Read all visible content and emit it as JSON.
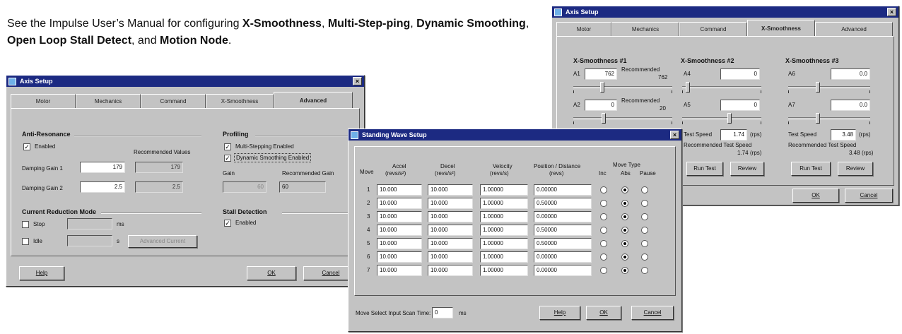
{
  "intro": {
    "t1": "See the Impulse User’s Manual for configuring ",
    "b1": "X-Smoothness",
    "t2": ", ",
    "b2": "Multi-Step-ping",
    "t3": ", ",
    "b3": "Dynamic Smoothing",
    "t4": ", ",
    "b4": "Open Loop Stall Detect",
    "t5": ", and ",
    "b5": "Motion Node",
    "t6": "."
  },
  "axis_left": {
    "title": "Axis Setup",
    "tabs": [
      "Motor",
      "Mechanics",
      "Command",
      "X-Smoothness",
      "Advanced"
    ],
    "active_tab": "Advanced",
    "anti_resonance": {
      "heading": "Anti-Resonance",
      "enabled_label": "Enabled",
      "enabled": true,
      "recommended_label": "Recommended Values",
      "gain1_label": "Damping Gain 1",
      "gain1_value": "179",
      "gain1_rec": "179",
      "gain2_label": "Damping Gain 2",
      "gain2_value": "2.5",
      "gain2_rec": "2.5"
    },
    "profiling": {
      "heading": "Profiling",
      "multi_label": "Multi-Stepping Enabled",
      "dynamic_label": "Dynamic Smoothing Enabled",
      "gain_label": "Gain",
      "rec_gain_label": "Recommended Gain",
      "gain_value": "60",
      "rec_gain_value": "60"
    },
    "current_reduction": {
      "heading": "Current Reduction Mode",
      "stop_label": "Stop",
      "stop_unit": "ms",
      "idle_label": "Idle",
      "idle_unit": "s",
      "apply_label": "Advanced Current"
    },
    "stall": {
      "heading": "Stall Detection",
      "enabled_label": "Enabled"
    },
    "buttons": {
      "help": "Help",
      "ok": "OK",
      "cancel": "Cancel"
    }
  },
  "axis_right": {
    "title": "Axis Setup",
    "tabs": [
      "Motor",
      "Mechanics",
      "Command",
      "X-Smoothness",
      "Advanced"
    ],
    "groups": [
      {
        "heading": "X-Smoothness #1",
        "a_label": "A1",
        "a_value": "762",
        "a_rec_label": "Recommended",
        "a_rec": "762",
        "b_label": "A2",
        "b_value": "0",
        "b_rec_label": "Recommended",
        "b_rec": "20",
        "thumb_a": 0.28,
        "thumb_b": 0.3
      },
      {
        "heading": "X-Smoothness #2",
        "a_label": "A4",
        "a_value": "0",
        "b_label": "A5",
        "b_value": "0",
        "thumb_a": 0.05,
        "thumb_b": 0.6
      },
      {
        "heading": "X-Smoothness #3",
        "a_label": "A6",
        "a_value": "0.0",
        "b_label": "A7",
        "b_value": "0.0",
        "thumb_a": 0.35,
        "thumb_b": 0.35
      }
    ],
    "test2": {
      "speed_label": "Test Speed",
      "speed_value": "1.74",
      "unit": "(rps)",
      "rec_label": "Recommended Test Speed",
      "rec_value": "1.74",
      "run": "Run Test",
      "review": "Review"
    },
    "test3": {
      "speed_label": "Test Speed",
      "speed_value": "3.48",
      "unit": "(rps)",
      "rec_label": "Recommended Test Speed",
      "rec_value": "3.48",
      "run": "Run Test",
      "review": "Review"
    },
    "buttons": {
      "ok": "OK",
      "cancel": "Cancel"
    }
  },
  "standing_wave": {
    "title": "Standing Wave Setup",
    "headers": {
      "move": "Move",
      "accel": "Accel",
      "accel_unit": "(revs/s²)",
      "decel": "Decel",
      "decel_unit": "(revs/s²)",
      "velocity": "Velocity",
      "velocity_unit": "(revs/s)",
      "position": "Position / Distance",
      "position_unit": "(revs)",
      "move_type": "Move Type",
      "inc": "Inc",
      "abs": "Abs",
      "pause": "Pause"
    },
    "rows": [
      {
        "move": "1",
        "accel": "10.000",
        "decel": "10.000",
        "velocity": "1.00000",
        "position": "0.00000",
        "type": "abs"
      },
      {
        "move": "2",
        "accel": "10.000",
        "decel": "10.000",
        "velocity": "1.00000",
        "position": "0.50000",
        "type": "abs"
      },
      {
        "move": "3",
        "accel": "10.000",
        "decel": "10.000",
        "velocity": "1.00000",
        "position": "0.00000",
        "type": "abs"
      },
      {
        "move": "4",
        "accel": "10.000",
        "decel": "10.000",
        "velocity": "1.00000",
        "position": "0.50000",
        "type": "abs"
      },
      {
        "move": "5",
        "accel": "10.000",
        "decel": "10.000",
        "velocity": "1.00000",
        "position": "0.50000",
        "type": "abs"
      },
      {
        "move": "6",
        "accel": "10.000",
        "decel": "10.000",
        "velocity": "1.00000",
        "position": "0.00000",
        "type": "abs"
      },
      {
        "move": "7",
        "accel": "10.000",
        "decel": "10.000",
        "velocity": "1.00000",
        "position": "0.00000",
        "type": "abs"
      }
    ],
    "scan_label": "Move Select Input Scan Time:",
    "scan_value": "0",
    "scan_unit": "ms",
    "buttons": {
      "help": "Help",
      "ok": "OK",
      "cancel": "Cancel"
    }
  }
}
